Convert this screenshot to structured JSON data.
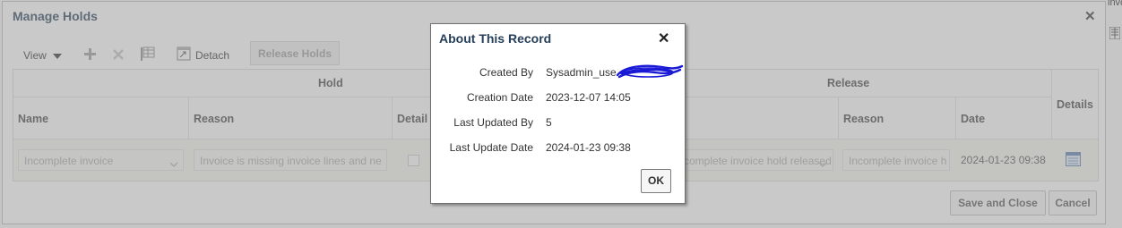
{
  "background_page": {
    "fragment_right": "invc"
  },
  "dialog": {
    "title": "Manage Holds",
    "close_glyph": "✕",
    "toolbar": {
      "view_label": "View",
      "detach_label": "Detach",
      "release_holds_label": "Release Holds"
    },
    "table": {
      "group_hold": "Hold",
      "group_release": "Release",
      "columns": {
        "name": "Name",
        "reason": "Reason",
        "details_short": "Detail",
        "release_reason": "Reason",
        "date": "Date",
        "details": "Details"
      },
      "rows": [
        {
          "name": "Incomplete invoice",
          "reason": "Invoice is missing invoice lines and ne",
          "release_name": "Incomplete invoice hold released",
          "release_reason": "Incomplete invoice h",
          "date": "2024-01-23 09:38"
        }
      ]
    },
    "buttons": {
      "save_close": "Save and Close",
      "cancel": "Cancel"
    }
  },
  "popup": {
    "title": "About This Record",
    "close_glyph": "✕",
    "fields": {
      "created_by_label": "Created By",
      "created_by_value": "Sysadmin_use",
      "creation_date_label": "Creation Date",
      "creation_date_value": "2023-12-07 14:05",
      "last_updated_by_label": "Last Updated By",
      "last_updated_by_value": "5",
      "last_update_date_label": "Last Update Date",
      "last_update_date_value": "2024-01-23 09:38"
    },
    "ok_label": "OK",
    "redaction_color": "#1a1ad6"
  },
  "colors": {
    "title": "#29435b",
    "overlay": "rgba(150,150,150,0.5)"
  }
}
